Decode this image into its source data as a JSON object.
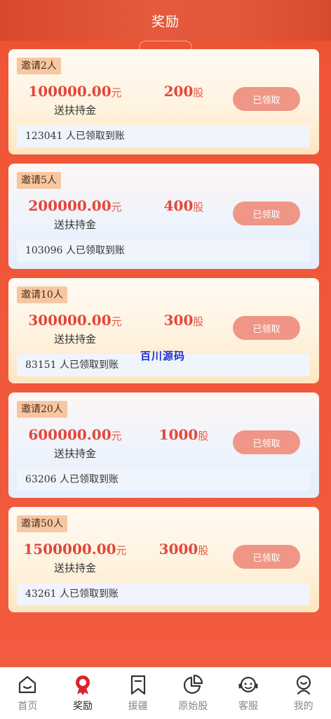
{
  "header": {
    "title": "奖励"
  },
  "rewards": [
    {
      "badge": "邀请2人",
      "amount": "100000.00",
      "amount_unit": "元",
      "amount_label": "送扶持金",
      "shares": "200",
      "shares_unit": "股",
      "claim_label": "已领取",
      "stat": "123041 人已领取到账",
      "style": "warm"
    },
    {
      "badge": "邀请5人",
      "amount": "200000.00",
      "amount_unit": "元",
      "amount_label": "送扶持金",
      "shares": "400",
      "shares_unit": "股",
      "claim_label": "已领取",
      "stat": "103096 人已领取到账",
      "style": "cool"
    },
    {
      "badge": "邀请10人",
      "amount": "300000.00",
      "amount_unit": "元",
      "amount_label": "送扶持金",
      "shares": "300",
      "shares_unit": "股",
      "claim_label": "已领取",
      "stat": "83151 人已领取到账",
      "style": "warm"
    },
    {
      "badge": "邀请20人",
      "amount": "600000.00",
      "amount_unit": "元",
      "amount_label": "送扶持金",
      "shares": "1000",
      "shares_unit": "股",
      "claim_label": "已领取",
      "stat": "63206 人已领取到账",
      "style": "cool"
    },
    {
      "badge": "邀请50人",
      "amount": "1500000.00",
      "amount_unit": "元",
      "amount_label": "送扶持金",
      "shares": "3000",
      "shares_unit": "股",
      "claim_label": "已领取",
      "stat": "43261 人已领取到账",
      "style": "warm"
    }
  ],
  "watermark": "百川源码",
  "tabbar": {
    "items": [
      {
        "label": "首页",
        "icon": "home-icon",
        "active": false
      },
      {
        "label": "奖励",
        "icon": "award-icon",
        "active": true
      },
      {
        "label": "援疆",
        "icon": "bookmark-icon",
        "active": false
      },
      {
        "label": "原始股",
        "icon": "pie-chart-icon",
        "active": false
      },
      {
        "label": "客服",
        "icon": "headset-icon",
        "active": false
      },
      {
        "label": "我的",
        "icon": "user-icon",
        "active": false
      }
    ]
  },
  "colors": {
    "accent": "#e3463a",
    "claim_button": "#ef9687",
    "badge": "#f7c7a1",
    "active_icon": "#d8252a"
  }
}
